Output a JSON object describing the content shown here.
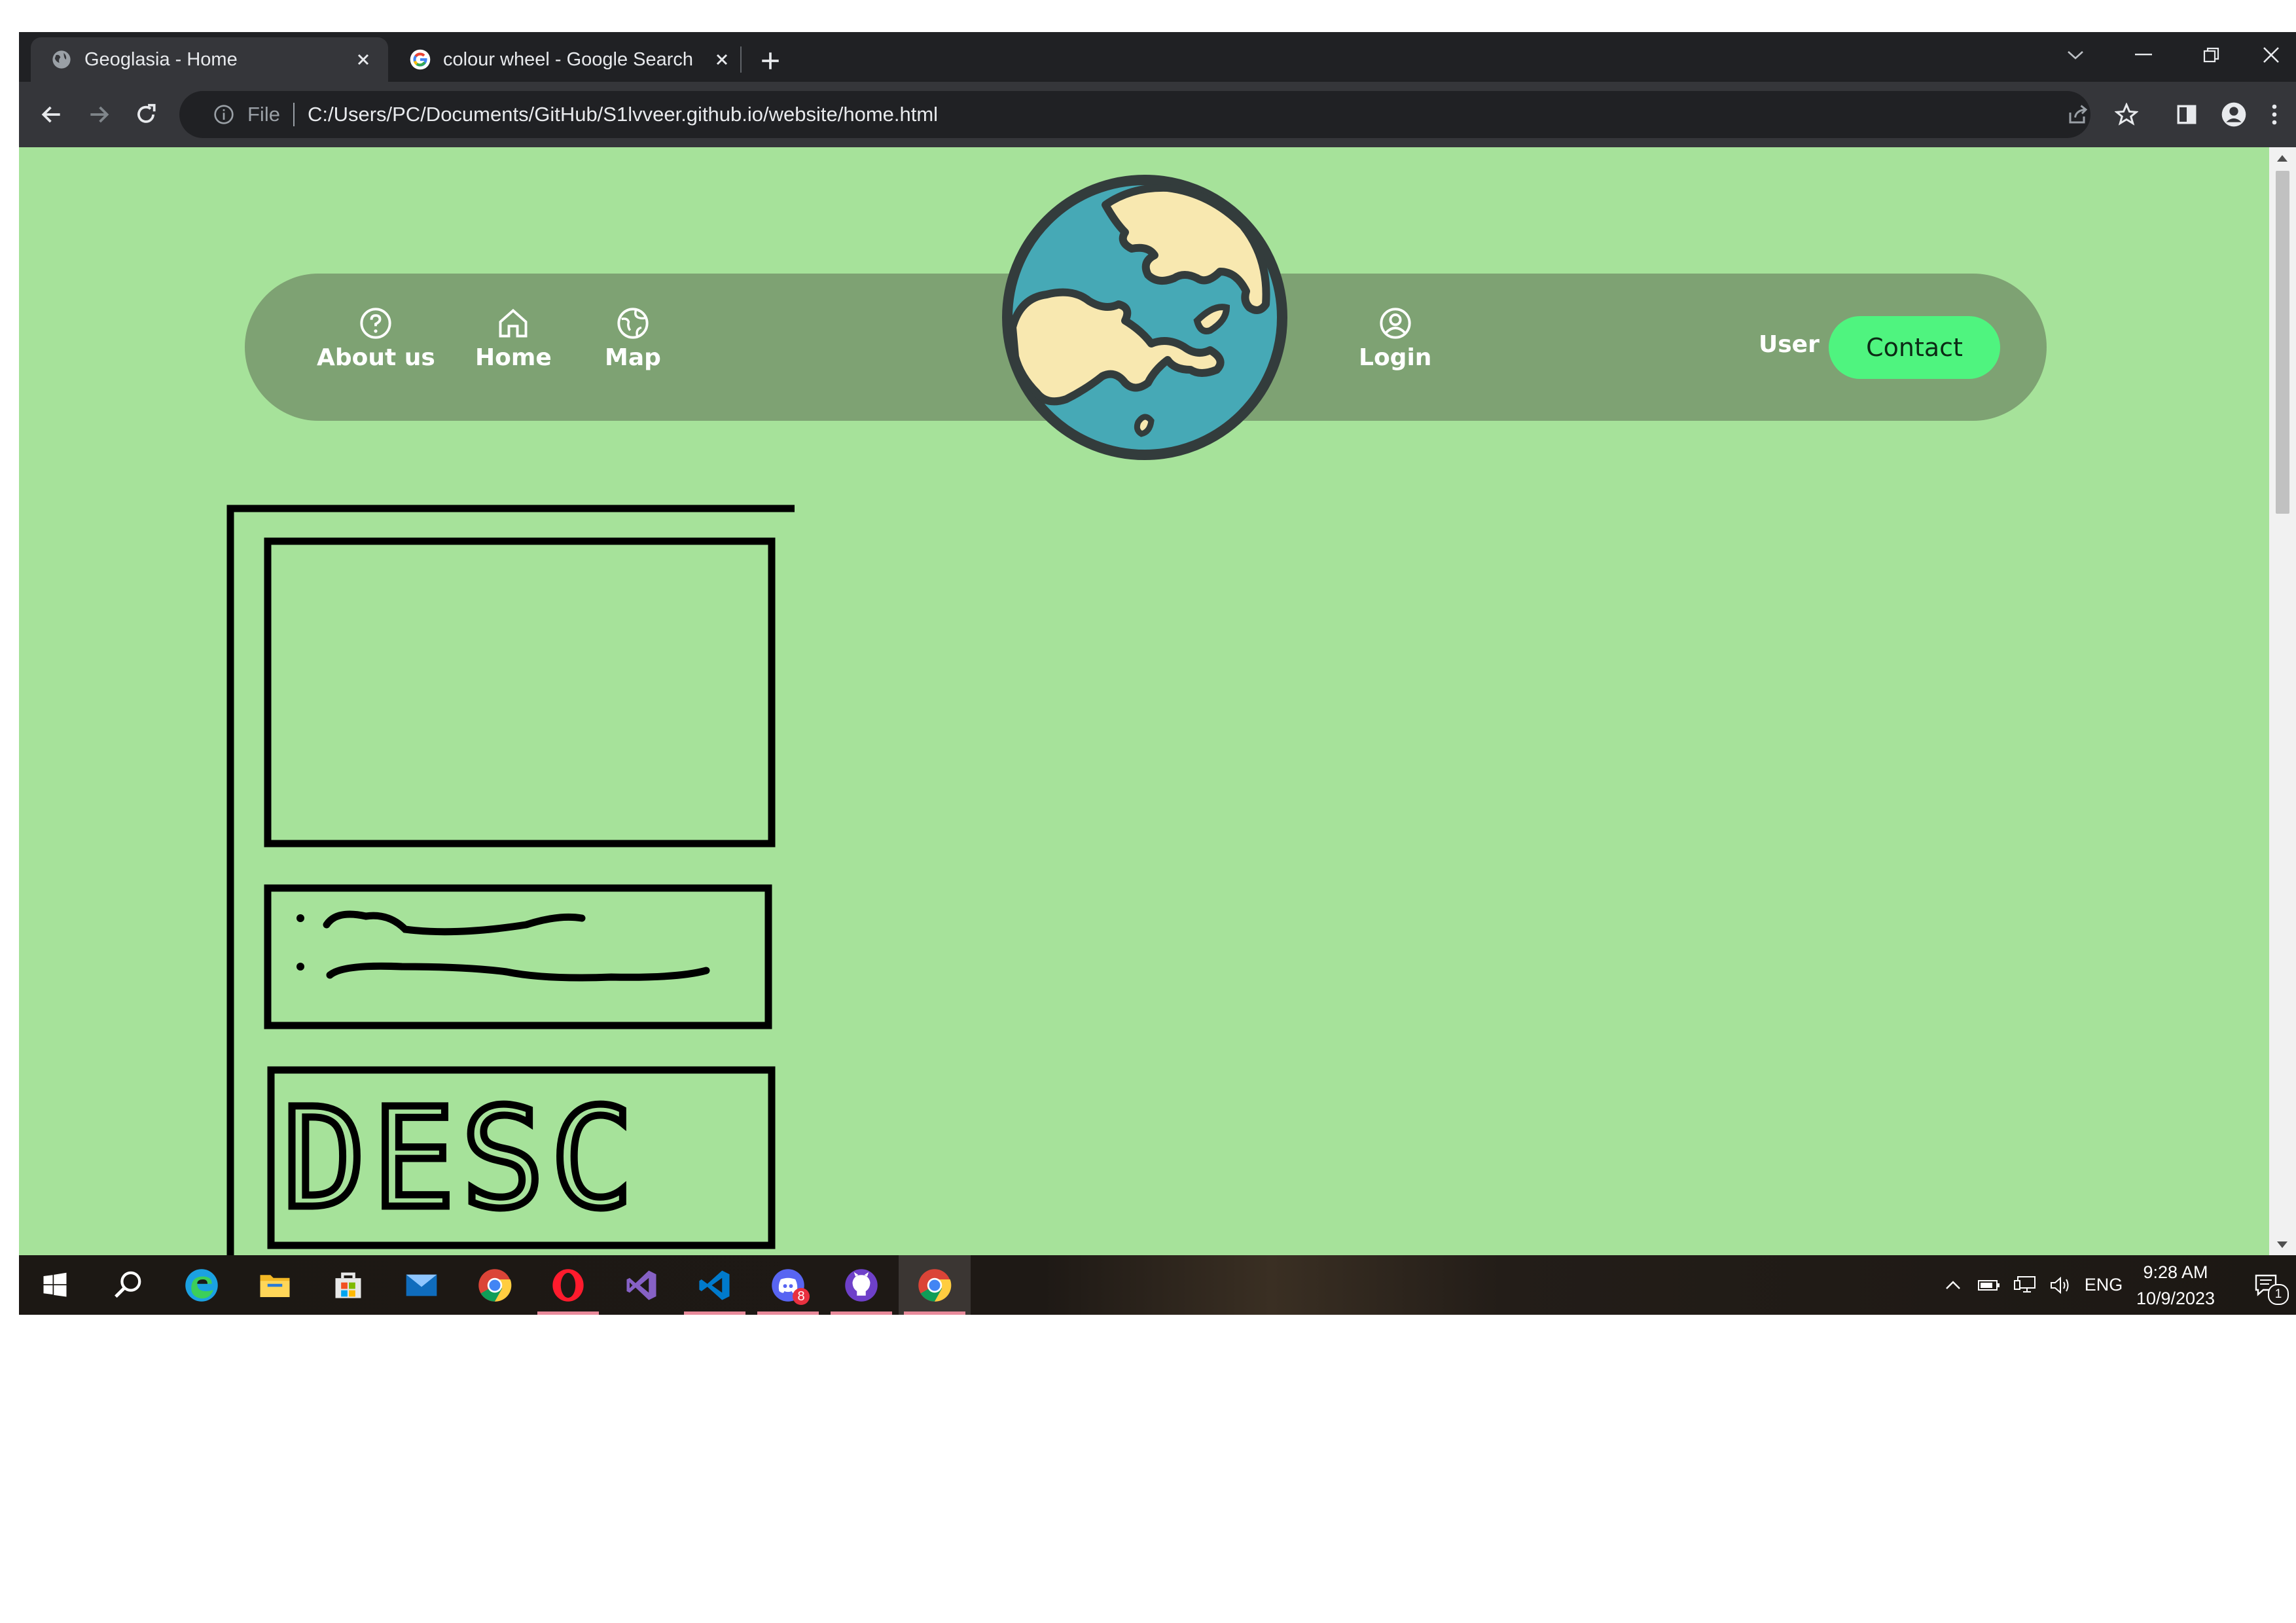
{
  "browser": {
    "tabs": [
      {
        "title": "Geoglasia - Home",
        "active": true,
        "icon": "globe-favicon"
      },
      {
        "title": "colour wheel - Google Search",
        "active": false,
        "icon": "google-favicon"
      }
    ],
    "address": {
      "scheme": "File",
      "url": "C:/Users/PC/Documents/GitHub/S1lvveer.github.io/website/home.html"
    }
  },
  "page": {
    "nav": {
      "items": [
        {
          "label": "About us",
          "icon": "question-icon"
        },
        {
          "label": "Home",
          "icon": "home-icon"
        },
        {
          "label": "Map",
          "icon": "globe-icon"
        },
        {
          "label": "Login",
          "icon": "user-circle-icon"
        }
      ],
      "user_label": "User",
      "contact_label": "Contact"
    },
    "sketch": {
      "desc_text": "DESC"
    },
    "colors": {
      "background": "#a6e29a",
      "navbar": "#7ea273",
      "contact": "#4ff47f",
      "globe_water": "#46a9b6",
      "globe_land": "#f8e8b0"
    }
  },
  "taskbar": {
    "apps": [
      "start-icon",
      "search-icon",
      "edge-icon",
      "file-explorer-icon",
      "store-icon",
      "mail-icon",
      "chrome-icon",
      "opera-icon",
      "visual-studio-icon",
      "vscode-icon",
      "discord-icon",
      "github-desktop-icon",
      "chrome-icon"
    ],
    "discord_badge": "8",
    "language": "ENG",
    "time": "9:28 AM",
    "date": "10/9/2023",
    "notification_count": "1"
  }
}
